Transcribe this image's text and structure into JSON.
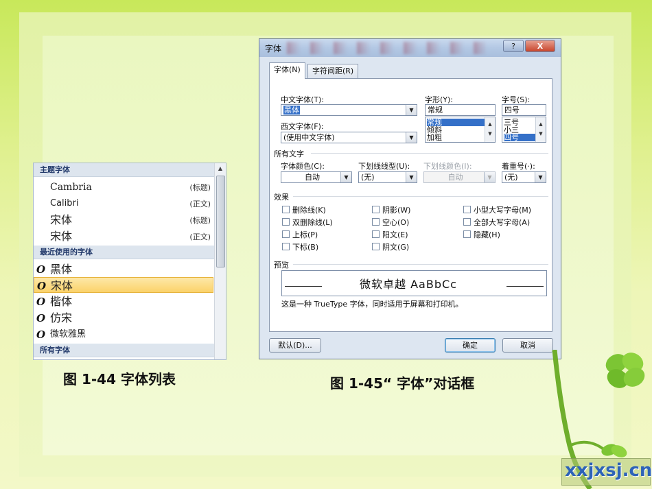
{
  "font_list": {
    "theme_header": "主题字体",
    "theme_items": [
      {
        "name": "Cambria",
        "tag": "(标题)"
      },
      {
        "name": "Calibri",
        "tag": "(正文)"
      },
      {
        "name": "宋体",
        "tag": "(标题)"
      },
      {
        "name": "宋体",
        "tag": "(正文)"
      }
    ],
    "recent_header": "最近使用的字体",
    "recent_items": [
      {
        "name": "黑体",
        "icon": "O"
      },
      {
        "name": "宋体",
        "icon": "O",
        "selected": true
      },
      {
        "name": "楷体",
        "icon": "O"
      },
      {
        "name": "仿宋",
        "icon": "O"
      },
      {
        "name": "微软雅黑",
        "icon": "O"
      }
    ],
    "all_header": "所有字体"
  },
  "captions": {
    "left": "图 1-44   字体列表",
    "right": "图 1-45“ 字体”对话框"
  },
  "dialog": {
    "title": "字体",
    "help_label": "?",
    "close_label": "X",
    "tabs": [
      "字体(N)",
      "字符间距(R)"
    ],
    "cn_font_label": "中文字体(T):",
    "cn_font_value": "黑体",
    "style_label": "字形(Y):",
    "style_value": "常规",
    "style_options": [
      "常规",
      "倾斜",
      "加粗"
    ],
    "size_label": "字号(S):",
    "size_value": "四号",
    "size_options": [
      "三号",
      "小三",
      "四号"
    ],
    "west_font_label": "西文字体(F):",
    "west_font_value": "(使用中文字体)",
    "all_text_label": "所有文字",
    "font_color_label": "字体颜色(C):",
    "font_color_value": "自动",
    "underline_label": "下划线线型(U):",
    "underline_value": "(无)",
    "underline_color_label": "下划线颜色(I):",
    "underline_color_value": "自动",
    "emphasis_label": "着重号(·):",
    "emphasis_value": "(无)",
    "effects_label": "效果",
    "effects": [
      [
        "删除线(K)",
        "阴影(W)",
        "小型大写字母(M)"
      ],
      [
        "双删除线(L)",
        "空心(O)",
        "全部大写字母(A)"
      ],
      [
        "上标(P)",
        "阳文(E)",
        "隐藏(H)"
      ],
      [
        "下标(B)",
        "阴文(G)",
        ""
      ]
    ],
    "preview_label": "预览",
    "preview_text": "微软卓越  AaBbCc",
    "note": "这是一种 TrueType 字体，同时适用于屏幕和打印机。",
    "default_button": "默认(D)...",
    "ok_button": "确定",
    "cancel_button": "取消"
  },
  "watermark": "xxjxsj.cn"
}
